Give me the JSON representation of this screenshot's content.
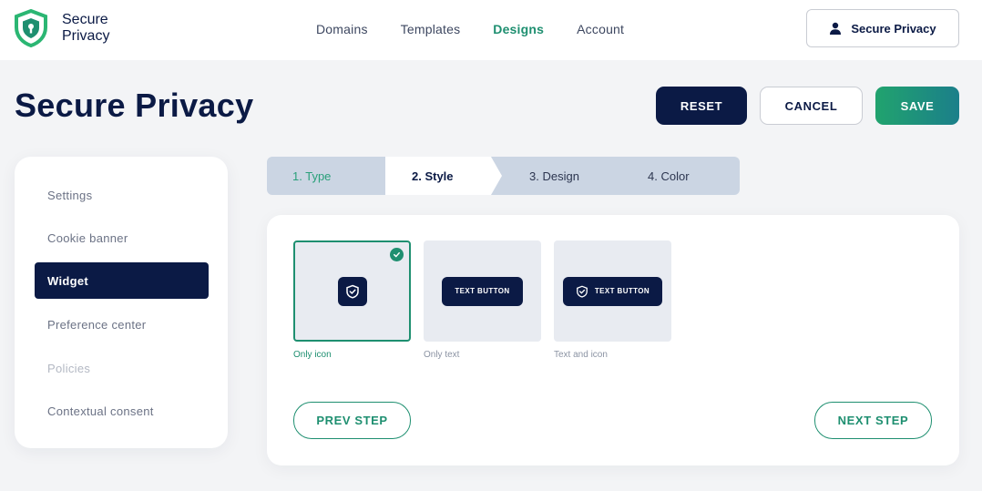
{
  "brand": {
    "name_line1": "Secure",
    "name_line2": "Privacy",
    "accent": "#1e8f70",
    "dark": "#0b1a45"
  },
  "nav": {
    "items": [
      {
        "label": "Domains",
        "active": false
      },
      {
        "label": "Templates",
        "active": false
      },
      {
        "label": "Designs",
        "active": true
      },
      {
        "label": "Account",
        "active": false
      }
    ]
  },
  "account_button": {
    "label": "Secure Privacy",
    "icon": "user-icon"
  },
  "page": {
    "title": "Secure Privacy"
  },
  "actions": {
    "reset": "RESET",
    "cancel": "CANCEL",
    "save": "SAVE"
  },
  "sidebar": {
    "items": [
      {
        "label": "Settings",
        "state": "normal"
      },
      {
        "label": "Cookie banner",
        "state": "normal"
      },
      {
        "label": "Widget",
        "state": "active"
      },
      {
        "label": "Preference center",
        "state": "normal"
      },
      {
        "label": "Policies",
        "state": "disabled"
      },
      {
        "label": "Contextual consent",
        "state": "normal"
      }
    ]
  },
  "steps": [
    {
      "label": "1. Type",
      "state": "done"
    },
    {
      "label": "2. Style",
      "state": "active"
    },
    {
      "label": "3. Design",
      "state": "todo"
    },
    {
      "label": "4. Color",
      "state": "todo"
    }
  ],
  "style_options": [
    {
      "label": "Only icon",
      "selected": true
    },
    {
      "label": "Only text",
      "selected": false,
      "chip_text": "TEXT BUTTON"
    },
    {
      "label": "Text and icon",
      "selected": false,
      "chip_text": "TEXT BUTTON"
    }
  ],
  "step_nav": {
    "prev": "PREV STEP",
    "next": "NEXT STEP"
  }
}
